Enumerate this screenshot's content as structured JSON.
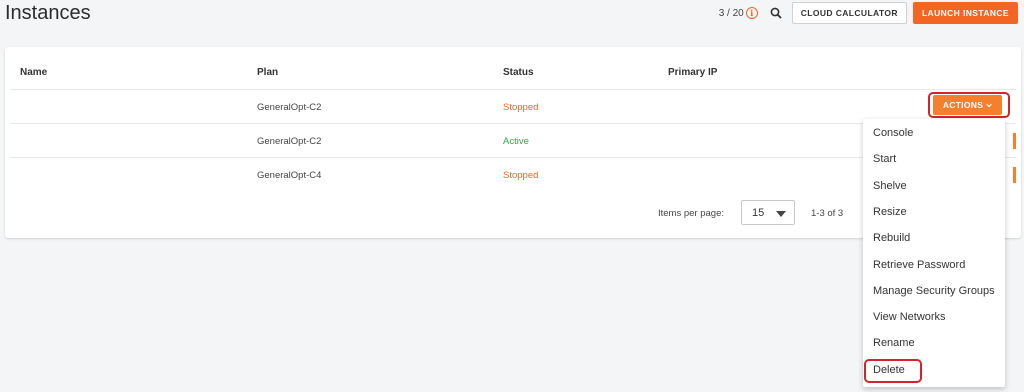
{
  "header": {
    "title": "Instances",
    "quota": "3 / 20",
    "cloud_calculator_label": "CLOUD CALCULATOR",
    "launch_instance_label": "LAUNCH INSTANCE"
  },
  "table": {
    "columns": [
      "Name",
      "Plan",
      "Status",
      "Primary IP"
    ],
    "rows": [
      {
        "name": "",
        "plan": "GeneralOpt-C2",
        "status": "Stopped",
        "primary_ip": ""
      },
      {
        "name": "",
        "plan": "GeneralOpt-C2",
        "status": "Active",
        "primary_ip": ""
      },
      {
        "name": "",
        "plan": "GeneralOpt-C4",
        "status": "Stopped",
        "primary_ip": ""
      }
    ],
    "actions_label": "ACTIONS"
  },
  "pagination": {
    "items_per_page_label": "Items per page:",
    "per_page_value": "15",
    "range": "1-3 of 3"
  },
  "actions_menu": {
    "items": [
      "Console",
      "Start",
      "Shelve",
      "Resize",
      "Rebuild",
      "Retrieve Password",
      "Manage Security Groups",
      "View Networks",
      "Rename",
      "Delete"
    ]
  },
  "colors": {
    "accent": "#f26522",
    "active": "#2ea84a",
    "highlight_ring": "#d3232f"
  },
  "icons": [
    "info-icon",
    "search-icon",
    "chevron-down-icon",
    "caret-down-icon"
  ]
}
